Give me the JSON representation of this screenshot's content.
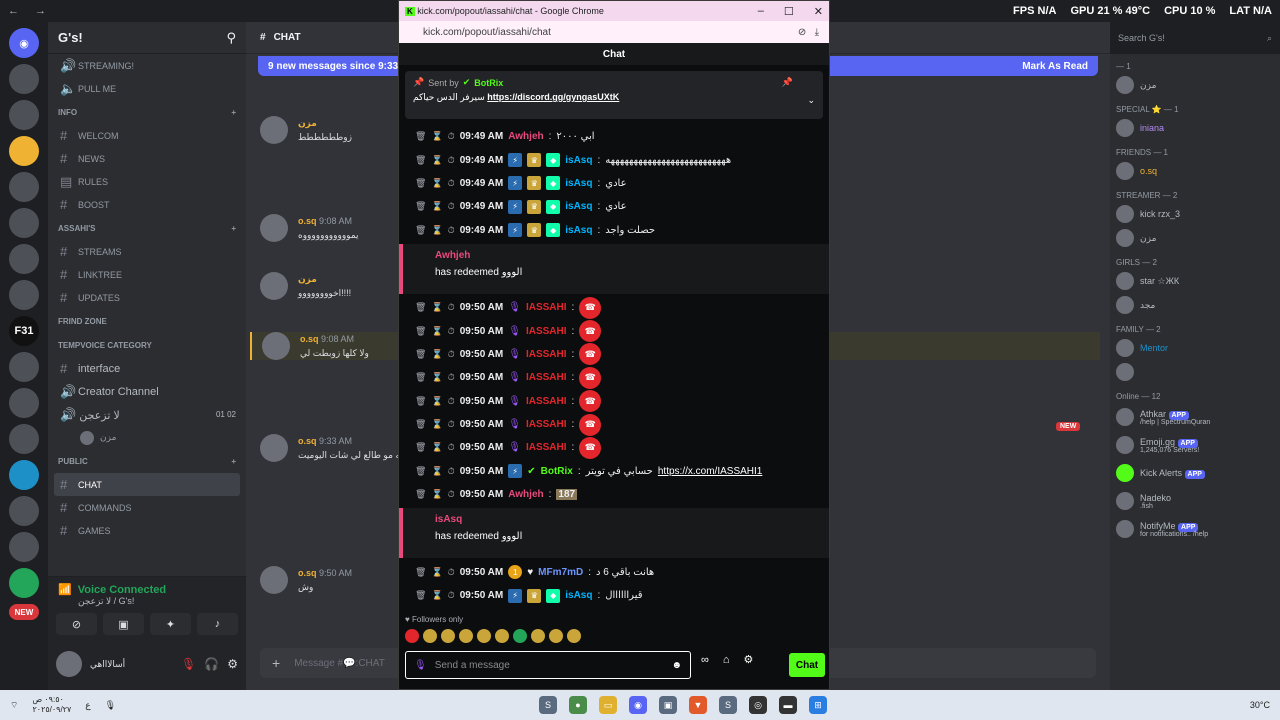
{
  "colors": {
    "kick_green": "#53fc18",
    "discord_blurple": "#5865f2",
    "redeem_pink": "#e94a7d",
    "end_red": "#e3262c",
    "voice_green": "#23a55a"
  },
  "topbar": {
    "hud_fps": "FPS N/A",
    "hud_gpu": "GPU 21 % 49°C",
    "hud_cpu": "CPU 10 %",
    "hud_lat": "LAT N/A"
  },
  "rail": {
    "servers": [
      "F31",
      "NEW"
    ]
  },
  "sidebar": {
    "server_name": "G's!",
    "channels_top": [
      "STREAMING!",
      "PULL ME"
    ],
    "cat_info": "INFO",
    "info_channels": [
      "WELCOM",
      "NEWS",
      "RULES",
      "BOOST"
    ],
    "cat_assahi": "ASSAHI'S",
    "assahi_channels": [
      "STREAMS",
      "LINKTREE",
      "UPDATES"
    ],
    "cat_frind": "FRIND ZONE",
    "cat_temp": "TEMPVOICE CATEGORY",
    "temp_channels": [
      "interface",
      "Creator Channel"
    ],
    "voice_channel": "لا تزعجن",
    "voice_counts": "01 02",
    "voice_member": "مزن",
    "cat_public": "PUBLIC",
    "public_channels": [
      "CHAT",
      "COMMANDS",
      "GAMES"
    ],
    "voice_connected": "Voice Connected",
    "voice_sub": "لا تزعجن / G's!",
    "username": "أسالاااهي"
  },
  "chat": {
    "channel": "CHAT",
    "new_messages": "9 new messages since 9:33 AM",
    "mark_read": "Mark As Read",
    "new_badge": "NEW",
    "input_placeholder": "Message #💬:CHAT",
    "messages": [
      {
        "name": "مزن",
        "time": "9:08 AM",
        "text": "زوطططططط"
      },
      {
        "name": "o.sq",
        "time": "9:08 AM",
        "text": "يموووووووووووه"
      },
      {
        "name": "مزن",
        "time": "9:08 AM",
        "text": "اخوووووووو!!!!"
      },
      {
        "name": "o.sq",
        "time": "9:08 AM",
        "text": "ولا كلها زوبطت لي"
      },
      {
        "name": "o.sq",
        "time": "9:33 AM",
        "text": "ليه مو طالع لي شات اليوميت"
      },
      {
        "name": "o.sq",
        "time": "9:50 AM",
        "text": "وش"
      }
    ]
  },
  "members": {
    "search": "Search G's!",
    "groups": [
      {
        "role": "— 1",
        "names": [
          "مزن"
        ]
      },
      {
        "role": "SPECIAL ⭐ — 1",
        "names": [
          "iniana"
        ]
      },
      {
        "role": "FRIENDS — 1",
        "names": [
          "o.sq"
        ]
      },
      {
        "role": "STREAMER — 2",
        "names": [
          "kick rzx_3",
          "مزن"
        ]
      },
      {
        "role": "GIRLS — 2",
        "names": [
          "star ☆ЖК",
          "مجد"
        ]
      },
      {
        "role": "FAMILY — 2",
        "names": [
          "Mentor",
          ""
        ]
      }
    ],
    "online": "Online — 12",
    "apps": [
      {
        "name": "Athkar",
        "sub": "/help | SpectrumQuran",
        "tag": "APP"
      },
      {
        "name": "Emoji.gg",
        "sub": "1,245,076 Servers!",
        "tag": "APP"
      },
      {
        "name": "Kick Alerts",
        "sub": "",
        "tag": "APP"
      },
      {
        "name": "Nadeko",
        "sub": ".fish",
        "tag": ""
      },
      {
        "name": "NotifyMe",
        "sub": "for notifications.. /help",
        "tag": "APP"
      }
    ]
  },
  "popup": {
    "title": "kick.com/popout/iassahi/chat - Google Chrome",
    "url": "kick.com/popout/iassahi/chat",
    "header": "Chat",
    "pinned_sentby": "Sent by",
    "pinned_author": "BotRix",
    "pinned_text": "سيرفر الدس حياكم",
    "pinned_link": "https://discord.gg/gyngasUXtK",
    "messages": [
      {
        "time": "09:49 AM",
        "user": "Awhjeh",
        "color": "#e94a7d",
        "text": "ابي ٢٠٠٠",
        "type": "text"
      },
      {
        "time": "09:49 AM",
        "user": "isAsq",
        "color": "#00b5ff",
        "text": "ههههههههههههههههههههههههههه",
        "type": "text"
      },
      {
        "time": "09:49 AM",
        "user": "isAsq",
        "color": "#00b5ff",
        "text": "عادي",
        "type": "text"
      },
      {
        "time": "09:49 AM",
        "user": "isAsq",
        "color": "#00b5ff",
        "text": "عادي",
        "type": "text"
      },
      {
        "time": "09:49 AM",
        "user": "isAsq",
        "color": "#00b5ff",
        "text": "حصلت واجد",
        "type": "text"
      }
    ],
    "redeem1": {
      "user": "Awhjeh",
      "text": "has redeemed الووو"
    },
    "iassahi_messages": [
      {
        "time": "09:50 AM",
        "user": "IASSAHI"
      },
      {
        "time": "09:50 AM",
        "user": "IASSAHI"
      },
      {
        "time": "09:50 AM",
        "user": "IASSAHI"
      },
      {
        "time": "09:50 AM",
        "user": "IASSAHI"
      },
      {
        "time": "09:50 AM",
        "user": "IASSAHI"
      },
      {
        "time": "09:50 AM",
        "user": "IASSAHI"
      },
      {
        "time": "09:50 AM",
        "user": "IASSAHI"
      }
    ],
    "botrix_msg": {
      "time": "09:50 AM",
      "user": "BotRix",
      "text": "حسابي في تويتر",
      "link": "https://x.com/IASSAHI1"
    },
    "awh_msg": {
      "time": "09:50 AM",
      "user": "Awhjeh",
      "text": "187"
    },
    "redeem2": {
      "user": "isAsq",
      "text": "has redeemed الووو"
    },
    "late_messages": [
      {
        "time": "09:50 AM",
        "user": "MFm7mD",
        "color": "#6e96ff",
        "text": "هانت باقي 6 د"
      },
      {
        "time": "09:50 AM",
        "user": "isAsq",
        "color": "#00b5ff",
        "text": "قيراااااال"
      }
    ],
    "followers": "Followers only",
    "input_placeholder": "Send a message",
    "send": "Chat"
  },
  "taskbar": {
    "time": "٠٩:٥٠ ص",
    "date": "٢٠٢٥/٠٩/٢٧",
    "weather": "30°C"
  }
}
